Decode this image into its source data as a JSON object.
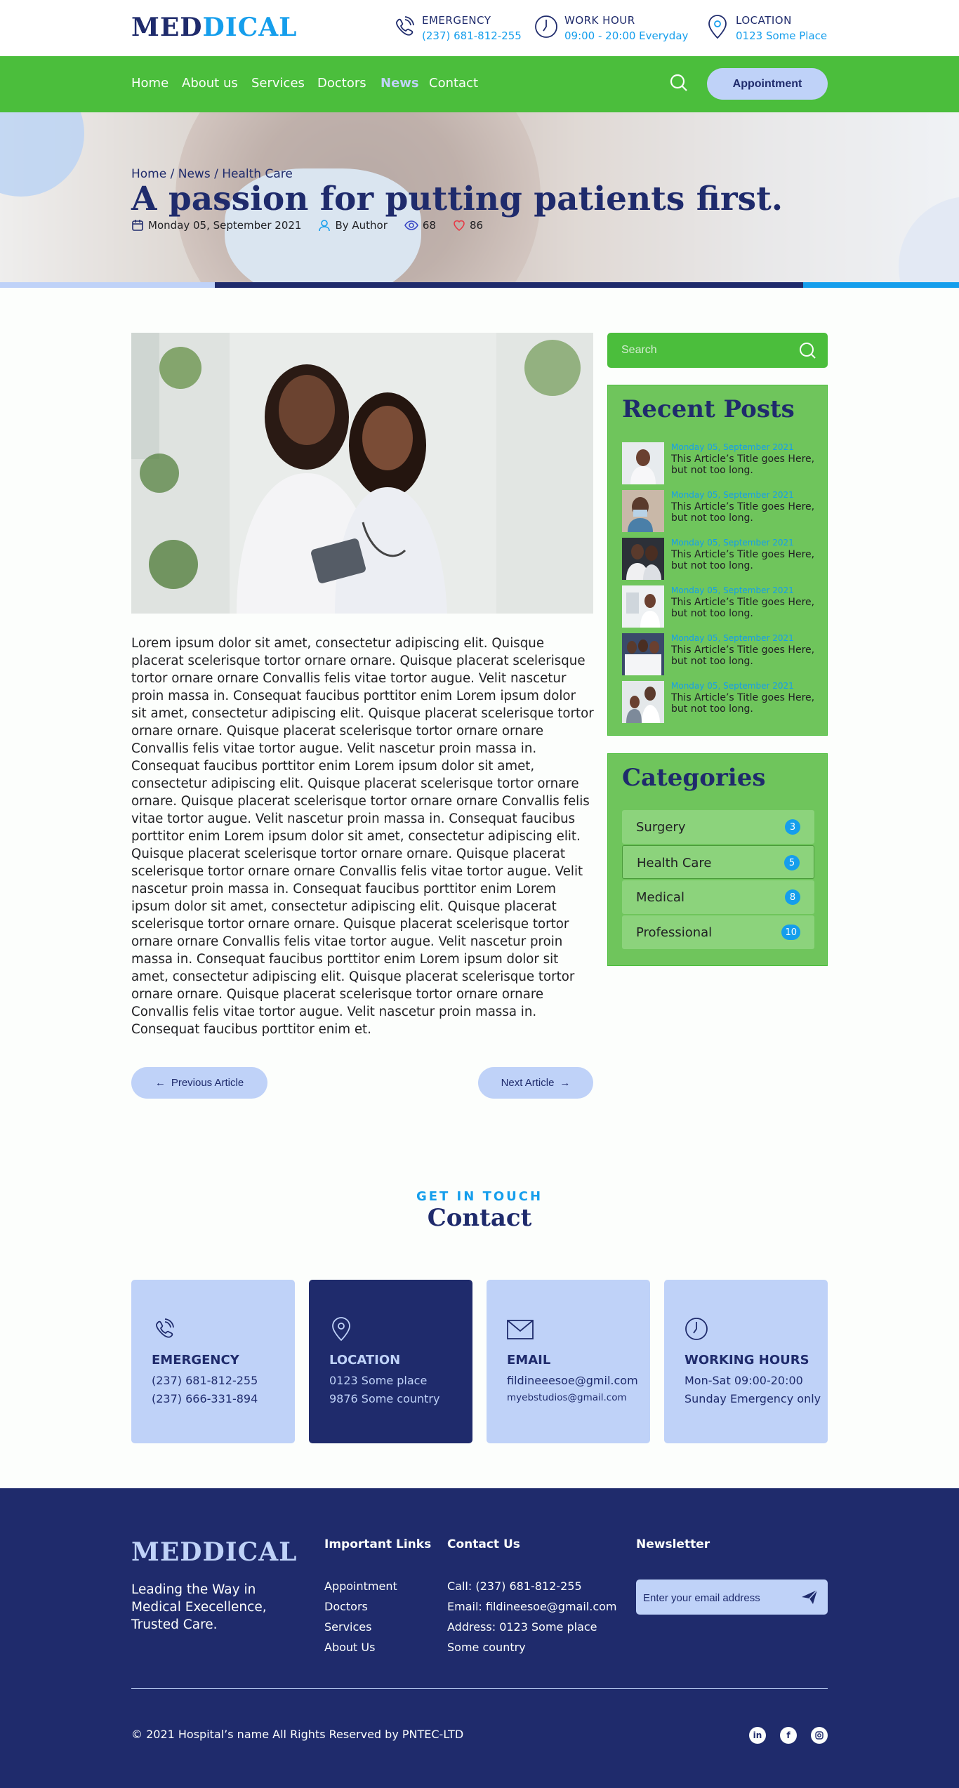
{
  "brand": {
    "logo_part1": "MED",
    "logo_part2": "DICAL",
    "footer_logo": "MEDDICAL"
  },
  "header": {
    "emergency": {
      "label": "EMERGENCY",
      "value": "(237) 681-812-255"
    },
    "work_hour": {
      "label": "WORK HOUR",
      "value": "09:00 - 20:00 Everyday"
    },
    "location": {
      "label": "LOCATION",
      "value": "0123 Some Place"
    }
  },
  "nav": {
    "items": [
      {
        "label": "Home"
      },
      {
        "label": "About us"
      },
      {
        "label": "Services"
      },
      {
        "label": "Doctors"
      },
      {
        "label": "News"
      },
      {
        "label": "Contact"
      }
    ],
    "appointment_label": "Appointment"
  },
  "hero": {
    "breadcrumb": [
      "Home",
      "News",
      "Health Care"
    ],
    "separator": "/",
    "title": "A passion for putting patients first.",
    "date": "Monday 05, September 2021",
    "author": "By Author",
    "views": "68",
    "likes": "86"
  },
  "article": {
    "body": "Lorem ipsum dolor sit amet, consectetur adipiscing elit. Quisque placerat scelerisque tortor ornare ornare. Quisque placerat scelerisque tortor ornare ornare Convallis felis vitae tortor augue. Velit nascetur proin massa in. Consequat faucibus porttitor enim Lorem ipsum dolor sit amet, consectetur adipiscing elit. Quisque placerat scelerisque tortor ornare ornare. Quisque placerat scelerisque tortor ornare ornare Convallis felis vitae tortor augue. Velit nascetur proin massa in. Consequat faucibus porttitor enim Lorem ipsum dolor sit amet, consectetur adipiscing elit. Quisque placerat scelerisque tortor ornare ornare. Quisque placerat scelerisque tortor ornare ornare Convallis felis vitae tortor augue. Velit nascetur proin massa in. Consequat faucibus porttitor enim Lorem ipsum dolor sit amet, consectetur adipiscing elit. Quisque placerat scelerisque tortor ornare ornare. Quisque placerat scelerisque tortor ornare ornare Convallis felis vitae tortor augue. Velit nascetur proin massa in. Consequat faucibus porttitor enim Lorem ipsum dolor sit amet, consectetur adipiscing elit. Quisque placerat scelerisque tortor ornare ornare. Quisque placerat scelerisque tortor ornare ornare Convallis felis vitae tortor augue. Velit nascetur proin massa in. Consequat faucibus porttitor enim Lorem ipsum dolor sit amet, consectetur adipiscing elit. Quisque placerat scelerisque tortor ornare ornare. Quisque placerat scelerisque tortor ornare ornare Convallis felis vitae tortor augue. Velit nascetur proin massa in. Consequat faucibus porttitor enim et.",
    "prev_label": "Previous Article",
    "next_label": "Next Article"
  },
  "sidebar": {
    "search_placeholder": "Search",
    "recent_title": "Recent Posts",
    "recent_posts": [
      {
        "date": "Monday 05, September 2021",
        "title": "This Article’s Title goes Here, but not too long."
      },
      {
        "date": "Monday 05, September 2021",
        "title": "This Article’s Title goes Here, but not too long."
      },
      {
        "date": "Monday 05, September 2021",
        "title": "This Article’s Title goes Here, but not too long."
      },
      {
        "date": "Monday 05, September 2021",
        "title": "This Article’s Title goes Here, but not too long."
      },
      {
        "date": "Monday 05, September 2021",
        "title": "This Article’s Title goes Here, but not too long."
      },
      {
        "date": "Monday 05, September 2021",
        "title": "This Article’s Title goes Here, but not too long."
      }
    ],
    "categories_title": "Categories",
    "categories": [
      {
        "label": "Surgery",
        "count": "3"
      },
      {
        "label": "Health Care",
        "count": "5"
      },
      {
        "label": "Medical",
        "count": "8"
      },
      {
        "label": "Professional",
        "count": "10"
      }
    ]
  },
  "contact": {
    "eyebrow": "GET IN TOUCH",
    "title": "Contact",
    "cards": [
      {
        "title": "EMERGENCY",
        "line1": "(237) 681-812-255",
        "line2": "(237) 666-331-894"
      },
      {
        "title": "LOCATION",
        "line1": "0123 Some place",
        "line2": "9876 Some country"
      },
      {
        "title": "EMAIL",
        "line1": "fildineeesoe@gmil.com",
        "line2": "myebstudios@gmail.com"
      },
      {
        "title": "WORKING HOURS",
        "line1": "Mon-Sat 09:00-20:00",
        "line2": "Sunday Emergency only"
      }
    ]
  },
  "footer": {
    "tagline": "Leading the Way in Medical Execellence, Trusted Care.",
    "links_title": "Important Links",
    "links": [
      "Appointment",
      "Doctors",
      "Services",
      "About Us"
    ],
    "contact_title": "Contact Us",
    "contact_lines": [
      "Call: (237) 681-812-255",
      "Email: fildineesoe@gmail.com",
      "Address: 0123 Some place",
      "Some country"
    ],
    "newsletter_title": "Newsletter",
    "newsletter_placeholder": "Enter your email address",
    "copyright": "© 2021 Hospital’s name All Rights Reserved by PNTEC-LTD",
    "social": [
      "linkedin-icon",
      "facebook-icon",
      "instagram-icon"
    ]
  },
  "colors": {
    "primary": "#1f2b6c",
    "accent": "#159eec",
    "green": "#4bbe3c",
    "light": "#bfd2f8"
  }
}
